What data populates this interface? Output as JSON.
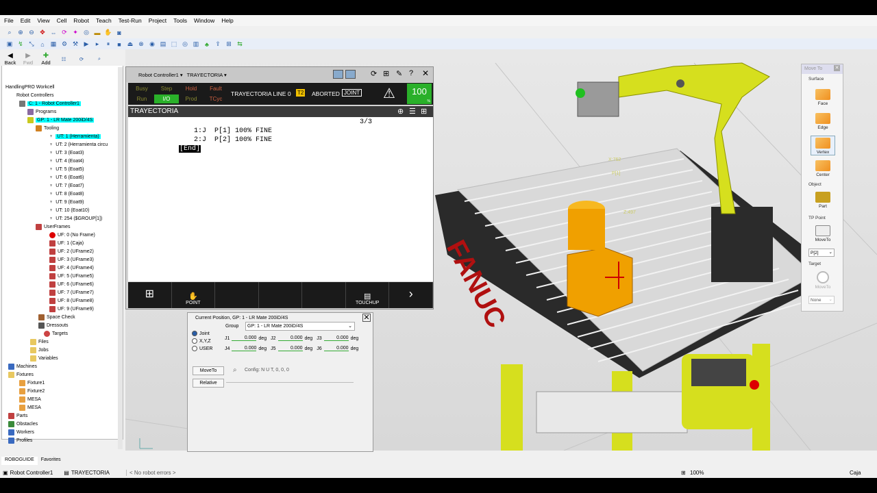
{
  "menu": [
    "File",
    "Edit",
    "View",
    "Cell",
    "Robot",
    "Teach",
    "Test-Run",
    "Project",
    "Tools",
    "Window",
    "Help"
  ],
  "left_toolbar": {
    "back": "Back",
    "fwd": "Fwd",
    "add": "Add"
  },
  "tree": {
    "root": "HandlingPRO Workcell",
    "controllers": "Robot Controllers",
    "controller": "C: 1 - Robot Controller1",
    "programs": "Programs",
    "group": "GP: 1 - LR Mate 200iD/4S",
    "tooling": "Tooling",
    "tools": [
      "UT: 1  (Herramienta)",
      "UT: 2  (Herramienta circu",
      "UT: 3  (Eoat3)",
      "UT: 4  (Eoat4)",
      "UT: 5  (Eoat5)",
      "UT: 6  (Eoat6)",
      "UT: 7  (Eoat7)",
      "UT: 8  (Eoat8)",
      "UT: 9  (Eoat9)",
      "UT: 10  (Eoat10)",
      "UT: 254  ($GROUP[1])"
    ],
    "userframes": "UserFrames",
    "frames": [
      "UF: 0  (No Frame)",
      "UF: 1  (Caja)",
      "UF: 2  (UFrame2)",
      "UF: 3  (UFrame3)",
      "UF: 4  (UFrame4)",
      "UF: 5  (UFrame5)",
      "UF: 6  (UFrame6)",
      "UF: 7  (UFrame7)",
      "UF: 8  (UFrame8)",
      "UF: 9  (UFrame9)"
    ],
    "spacecheck": "Space Check",
    "dresssouts": "Dressouts",
    "targets": "Targets",
    "files": "Files",
    "jobs": "Jobs",
    "variables": "Variables",
    "machines": "Machines",
    "fixtures": "Fixtures",
    "fixture_items": [
      "Fixture1",
      "Fixture2",
      "MESA",
      "MESA"
    ],
    "parts": "Parts",
    "obstacles": "Obstacles",
    "workers": "Workers",
    "profiles": "Profiles"
  },
  "tabs": {
    "left": "ROBOGUIDE",
    "right": "Favorites"
  },
  "tp": {
    "title": "Robot Controller1",
    "program_dd": "TRAYECTORIA",
    "lamps": [
      "Busy",
      "Step",
      "Hold",
      "Fault",
      "Run",
      "I/O",
      "Prod",
      "TCyc"
    ],
    "status": "TRAYECTORIA LINE 0",
    "t2": "T2",
    "aborted": "ABORTED",
    "joint": "JOINT",
    "override": "100",
    "pct": "%",
    "prog_name": "TRAYECTORIA",
    "counter": "3/3",
    "lines": [
      "1:J  P[1] 100% FINE",
      "2:J  P[2] 100% FINE"
    ],
    "end": "[End]",
    "fkeys": {
      "point": "POINT",
      "touchup": "TOUCHUP"
    }
  },
  "curpos": {
    "title": "Current Position, GP: 1 - LR Mate 200iD/4S",
    "group_label": "Group",
    "group_value": "GP: 1 - LR Mate 200iD/4S",
    "radios": [
      "Joint",
      "X,Y,Z",
      "USER"
    ],
    "j1": "J1",
    "j2": "J2",
    "j3": "J3",
    "j4": "J4",
    "j5": "J5",
    "j6": "J6",
    "val": "0.000",
    "unit": "deg",
    "moveto": "MoveTo",
    "relative": "Relative",
    "config": "Config: N U T, 0, 0, 0"
  },
  "moveto_panel": {
    "title": "Move To",
    "surface": "Surface",
    "face": "Face",
    "edge": "Edge",
    "vertex": "Vertex",
    "center": "Center",
    "object": "Object",
    "part": "Part",
    "tppoint": "TP Point",
    "moveto": "MoveTo",
    "point_sel": "P[2]",
    "target": "Target",
    "target_moveto": "MoveTo",
    "none": "None"
  },
  "scene": {
    "x_label": "X:762",
    "p1": "P[1]",
    "z_label": "Z:497",
    "fanuc": "FANUC"
  },
  "statusbar": {
    "controller": "Robot Controller1",
    "program": "TRAYECTORIA",
    "errors": "< No robot errors >",
    "zoom": "100%",
    "frame": "Caja"
  },
  "colors": {
    "robot_yellow": "#d6df1e",
    "orange_part": "#f0a000",
    "tp_green": "#2ab02a",
    "cyan_highlight": "#00ffff"
  }
}
